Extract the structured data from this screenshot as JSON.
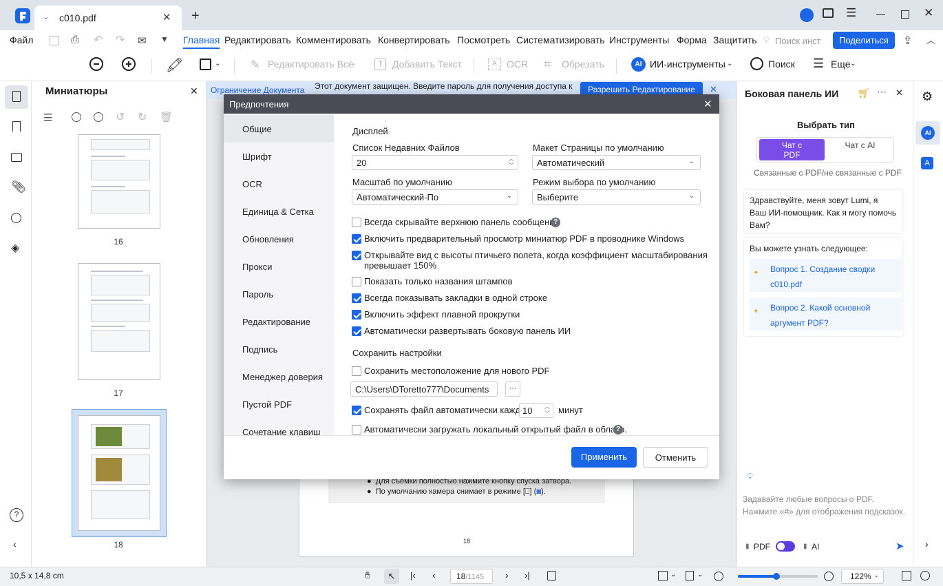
{
  "titlebar": {
    "tab_title": "c010.pdf"
  },
  "menu": {
    "file": "Файл",
    "items": [
      "Главная",
      "Редактировать",
      "Комментировать",
      "Конвертировать",
      "Посмотреть",
      "Систематизировать",
      "Инструменты",
      "Форма",
      "Защитить"
    ],
    "search_placeholder": "Поиск инст",
    "share": "Поделиться"
  },
  "toolbar": {
    "edit_all": "Редактировать Всё",
    "add_text": "Добавить Текст",
    "ocr": "OCR",
    "crop": "Обрезать",
    "ai_tools": "ИИ-инструменты",
    "search": "Поиск",
    "more": "Еще"
  },
  "thumbnails": {
    "title": "Миниатюры",
    "pages": [
      "16",
      "17",
      "18"
    ]
  },
  "notice": {
    "left": "Ограничение Документа",
    "text": "Этот документ защищен. Введите пароль для получения доступа к",
    "button": "Разрешить Редактирование"
  },
  "doc": {
    "bullet1": "Для съемки полностью нажмите кнопку спуска затвора.",
    "bullet2": "По умолчанию камера снимает в режиме [",
    "bullet2_end": "] (",
    "bullet2_tail": ").",
    "page_number": "18"
  },
  "modal": {
    "title": "Предпочтения",
    "nav": [
      "Общие",
      "Шрифт",
      "OCR",
      "Единица & Сетка",
      "Обновления",
      "Прокси",
      "Пароль",
      "Редактирование",
      "Подпись",
      "Менеджер доверия",
      "Пустой PDF",
      "Сочетание клавиш"
    ],
    "display_heading": "Дисплей",
    "recent_label": "Список Недавних Файлов",
    "recent_value": "20",
    "layout_label": "Макет Страницы по умолчанию",
    "layout_value": "Автоматический",
    "zoom_label": "Масштаб по умолчанию",
    "zoom_value": "Автоматический-По",
    "select_label": "Режим выбора по умолчанию",
    "select_value": "Выберите",
    "options": [
      {
        "label": "Всегда скрывайте верхнюю панель сообщений",
        "checked": false
      },
      {
        "label": "Включить предварительный просмотр миниатюр PDF в проводнике Windows",
        "checked": true
      },
      {
        "label": "Открывайте вид с высоты птичьего полета, когда коэффициент масштабирования",
        "label2": "превышает 150%",
        "checked": true
      },
      {
        "label": "Показать только названия штампов",
        "checked": false
      },
      {
        "label": "Всегда показывать закладки в одной строке",
        "checked": true
      },
      {
        "label": "Включить эффект плавной прокрутки",
        "checked": true
      },
      {
        "label": "Автоматически развертывать боковую панель ИИ",
        "checked": true
      }
    ],
    "save_heading": "Сохранить настройки",
    "save_location": "Сохранить местоположение для нового PDF",
    "save_location_checked": false,
    "path": "C:\\Users\\DToretto777\\Documents",
    "path_btn": "···",
    "autosave_label": "Сохранять файл автоматически каждые",
    "autosave_checked": true,
    "autosave_value": "10",
    "autosave_unit": "минут",
    "upload_label": "Автоматически загружать локальный открытый файл в облако.",
    "upload_checked": false,
    "apply": "Применить",
    "cancel": "Отменить"
  },
  "ai": {
    "title": "Боковая панель ИИ",
    "choose_type": "Выбрать тип",
    "opt1": "Чат с PDF",
    "opt2": "Чат с AI",
    "subtitle": "Связанные с PDF/не связанные с PDF",
    "greeting": "Здравствуйте, меня зовут Lumi, я Ваш ИИ-помощник. Как я могу помочь Вам?",
    "learn": "Вы можете узнать следующее:",
    "q1": "Вопрос 1. Создание сводки c010.pdf",
    "q2": "Вопрос 2. Какой основной аргумент PDF?",
    "input_hint": "Задавайте любые вопросы о PDF. Нажмите «#» для отображения подсказок.",
    "toggle_pdf": "PDF",
    "toggle_ai": "AI"
  },
  "status": {
    "size": "10,5 x 14,8 cm",
    "page": "18",
    "total": "/1145",
    "zoom": "122%",
    "zoom_fraction": 0.48
  },
  "colors": {
    "accent": "#1b66e6",
    "modal_header": "#4a4c55"
  }
}
